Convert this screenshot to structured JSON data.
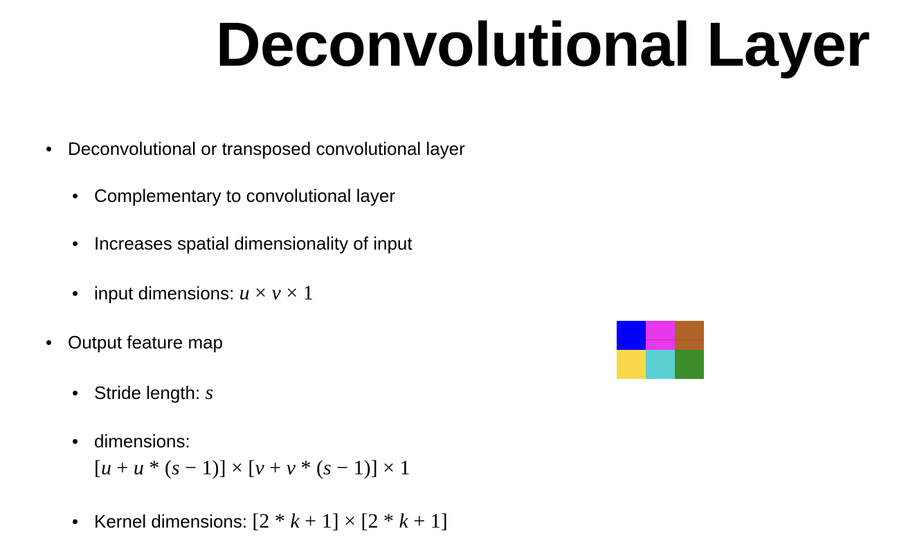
{
  "title": "Deconvolutional Layer",
  "bullets": {
    "b1": "Deconvolutional or transposed convolutional layer",
    "b1_1": "Complementary to convolutional layer",
    "b1_2": "Increases spatial dimensionality of input",
    "b1_3_label": "input dimensions: ",
    "b1_3_math": {
      "u": "u",
      "times": "×",
      "v": "v",
      "one": "1"
    },
    "b2": "Output feature map",
    "b2_1_label": "Stride length: ",
    "b2_1_math": "s",
    "b2_2_label": "dimensions:",
    "b2_3_label": "Kernel dimensions: "
  },
  "bullet_glyph": "•",
  "grid_colors": {
    "c00": "#0000ff",
    "c01": "#e838f0",
    "c02": "#b06426",
    "c10": "#f8d84a",
    "c11": "#5ccfd2",
    "c12": "#3c8c2a"
  }
}
